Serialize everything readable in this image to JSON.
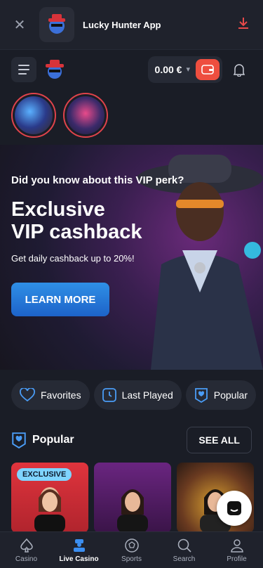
{
  "app_banner": {
    "title": "Lucky Hunter App"
  },
  "header": {
    "balance": "0.00 €"
  },
  "promo": {
    "question": "Did you know about this VIP perk?",
    "headline_line1": "Exclusive",
    "headline_line2": "VIP cashback",
    "subtitle": "Get daily cashback up to 20%!",
    "cta": "LEARN MORE"
  },
  "chips": [
    {
      "label": "Favorites",
      "icon": "heart-icon"
    },
    {
      "label": "Last Played",
      "icon": "clock-icon"
    },
    {
      "label": "Popular",
      "icon": "heart-badge-icon"
    }
  ],
  "section": {
    "title": "Popular",
    "see_all": "SEE ALL"
  },
  "games": [
    {
      "badge": "EXCLUSIVE",
      "color": "#e0343d"
    },
    {
      "color": "#5a1f6a"
    },
    {
      "color": "#3a2a1a"
    }
  ],
  "bottom_nav": [
    {
      "label": "Casino",
      "icon": "spade-icon"
    },
    {
      "label": "Live Casino",
      "icon": "dealer-icon",
      "active": true
    },
    {
      "label": "Sports",
      "icon": "ball-icon"
    },
    {
      "label": "Search",
      "icon": "search-icon"
    },
    {
      "label": "Profile",
      "icon": "profile-icon"
    }
  ]
}
